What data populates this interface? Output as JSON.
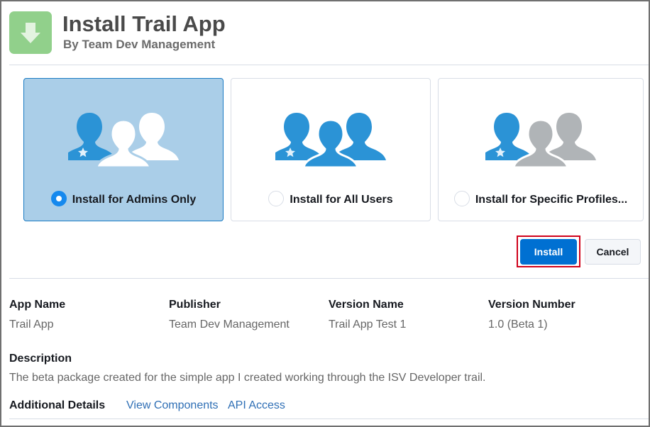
{
  "header": {
    "icon": "download-arrow-icon",
    "title": "Install Trail App",
    "subtitle": "By Team Dev Management"
  },
  "install_options": [
    {
      "label": "Install for Admins Only",
      "selected": true,
      "icon": "admin-users-icon"
    },
    {
      "label": "Install for All Users",
      "selected": false,
      "icon": "all-users-icon"
    },
    {
      "label": "Install for Specific Profiles...",
      "selected": false,
      "icon": "specific-profiles-icon"
    }
  ],
  "actions": {
    "install_label": "Install",
    "cancel_label": "Cancel"
  },
  "details": {
    "fields": [
      {
        "label": "App Name",
        "value": "Trail App"
      },
      {
        "label": "Publisher",
        "value": "Team Dev Management"
      },
      {
        "label": "Version Name",
        "value": "Trail App Test 1"
      },
      {
        "label": "Version Number",
        "value": "1.0 (Beta 1)"
      }
    ],
    "description_label": "Description",
    "description": "The beta package created for the simple app I created working through the ISV Developer trail.",
    "additional_label": "Additional Details",
    "links": [
      "View Components",
      "API Access"
    ]
  },
  "colors": {
    "accent": "#0070d2",
    "selected_card": "#aacee8",
    "person_blue": "#2b93d6",
    "person_gray": "#b0b4b7",
    "app_icon_green": "#91d08b",
    "highlight_red": "#d0021b"
  }
}
